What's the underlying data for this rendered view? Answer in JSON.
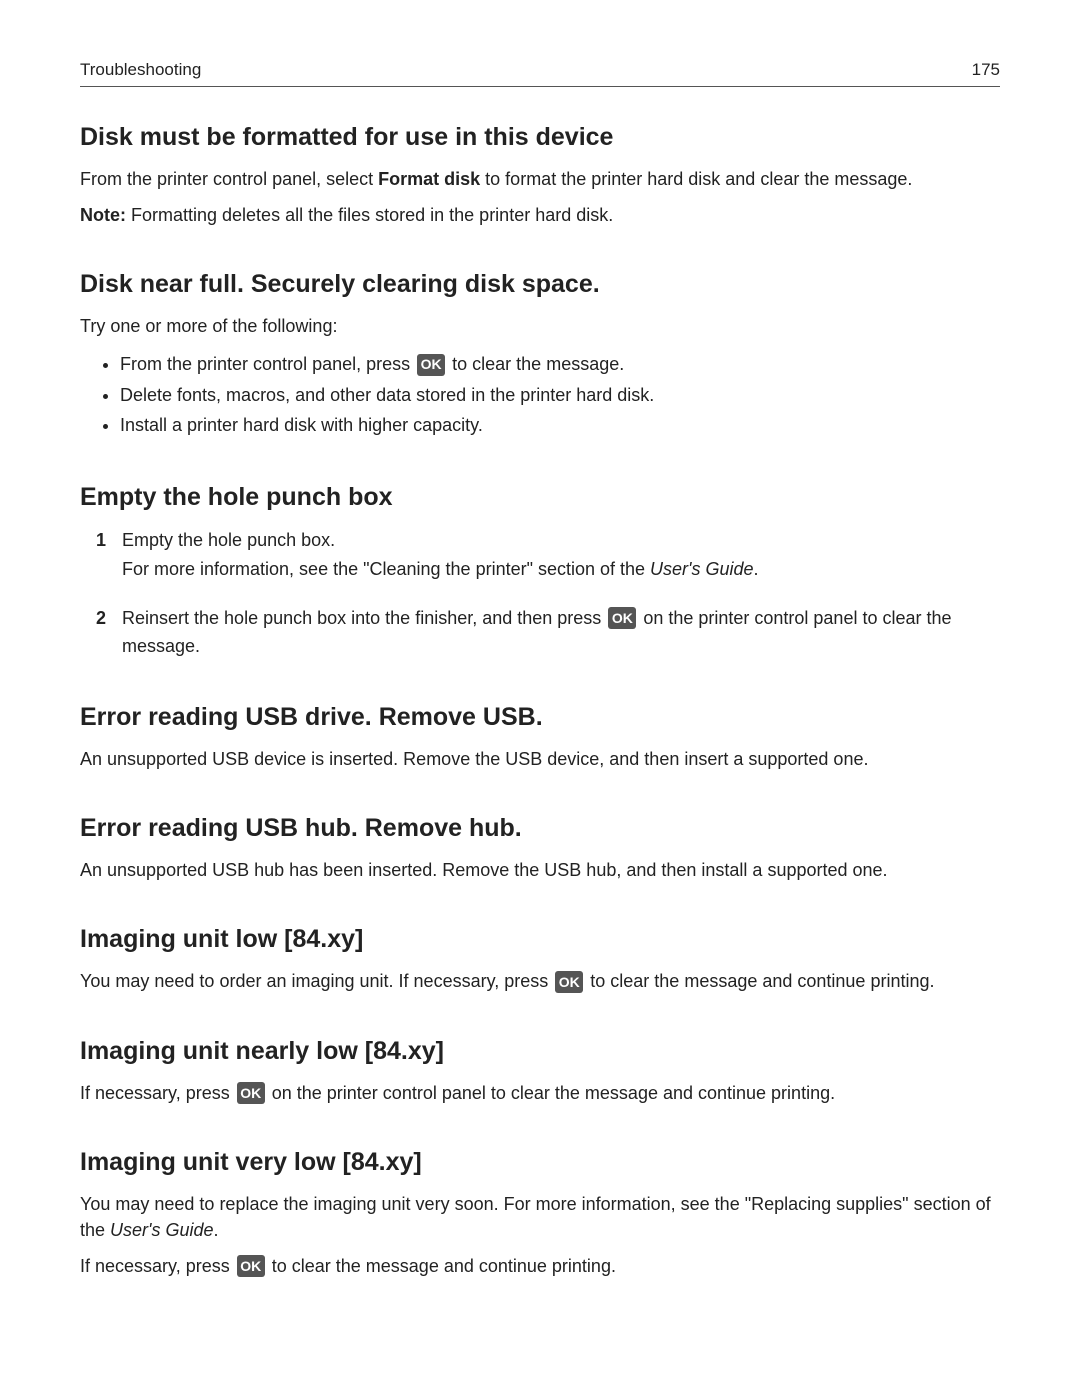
{
  "header": {
    "title": "Troubleshooting",
    "page": "175"
  },
  "ok_label": "OK",
  "sections": {
    "s1": {
      "heading": "Disk must be formatted for use in this device",
      "p1a": "From the printer control panel, select ",
      "p1bold": "Format disk",
      "p1b": " to format the printer hard disk and clear the message.",
      "p2a": "Note:",
      "p2b": " Formatting deletes all the files stored in the printer hard disk."
    },
    "s2": {
      "heading": "Disk near full. Securely clearing disk space.",
      "intro": "Try one or more of the following:",
      "b1a": "From the printer control panel, press ",
      "b1b": " to clear the message.",
      "b2": "Delete fonts, macros, and other data stored in the printer hard disk.",
      "b3": "Install a printer hard disk with higher capacity."
    },
    "s3": {
      "heading": "Empty the hole punch box",
      "o1line1": "Empty the hole punch box.",
      "o1line2a": "For more information, see the \"Cleaning the printer\" section of the ",
      "o1line2ital": "User's Guide",
      "o1line2end": ".",
      "o2a": "Reinsert the hole punch box into the finisher, and then press ",
      "o2b": " on the printer control panel to clear the message."
    },
    "s4": {
      "heading": "Error reading USB drive. Remove USB.",
      "p1": "An unsupported USB device is inserted. Remove the USB device, and then insert a supported one."
    },
    "s5": {
      "heading": "Error reading USB hub. Remove hub.",
      "p1": "An unsupported USB hub has been inserted. Remove the USB hub, and then install a supported one."
    },
    "s6": {
      "heading": "Imaging unit low [84.xy]",
      "p1a": "You may need to order an imaging unit. If necessary, press ",
      "p1b": " to clear the message and continue printing."
    },
    "s7": {
      "heading": "Imaging unit nearly low [84.xy]",
      "p1a": "If necessary, press ",
      "p1b": " on the printer control panel to clear the message and continue printing."
    },
    "s8": {
      "heading": "Imaging unit very low [84.xy]",
      "p1a": "You may need to replace the imaging unit very soon. For more information, see the \"Replacing supplies\" section of the ",
      "p1ital": "User's Guide",
      "p1end": ".",
      "p2a": "If necessary, press ",
      "p2b": " to clear the message and continue printing."
    }
  }
}
